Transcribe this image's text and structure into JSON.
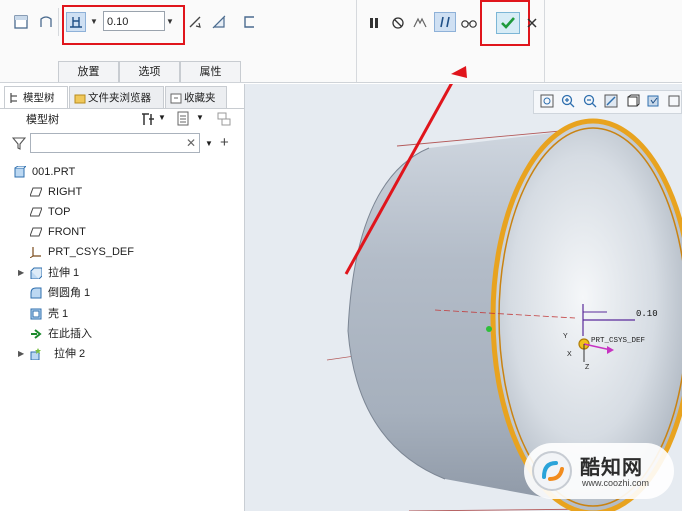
{
  "dashboard": {
    "depth_value": "0.10",
    "tabs": [
      {
        "label": "放置"
      },
      {
        "label": "选项"
      },
      {
        "label": "属性"
      }
    ]
  },
  "model_panel": {
    "tabs": [
      {
        "label": "模型树"
      },
      {
        "label": "文件夹浏览器"
      },
      {
        "label": "收藏夹"
      }
    ],
    "header": "模型树",
    "filter_placeholder": "",
    "tree": [
      {
        "label": "001.PRT",
        "icon": "part-icon"
      },
      {
        "label": "RIGHT",
        "icon": "datum-plane-icon"
      },
      {
        "label": "TOP",
        "icon": "datum-plane-icon"
      },
      {
        "label": "FRONT",
        "icon": "datum-plane-icon"
      },
      {
        "label": "PRT_CSYS_DEF",
        "icon": "csys-icon"
      },
      {
        "label": "拉伸 1",
        "icon": "extrude-icon"
      },
      {
        "label": "倒圆角 1",
        "icon": "round-icon"
      },
      {
        "label": "壳 1",
        "icon": "shell-icon"
      },
      {
        "label": "在此插入",
        "icon": "insert-arrow-icon"
      },
      {
        "label": "拉伸 2",
        "icon": "extrude-new-icon"
      }
    ]
  },
  "viewport": {
    "dimension_label": "0.10",
    "csys_label": "PRT_CSYS_DEF",
    "axis_labels": {
      "x": "X",
      "y": "Y",
      "z": "Z"
    }
  },
  "watermark": {
    "brand": "酷知网",
    "url": "www.coozhi.com"
  },
  "colors": {
    "highlight_red": "#e0151c",
    "model_gray": "#b7c0cc",
    "edge_orange": "#e8a31f",
    "check_green": "#1f9a3c"
  }
}
